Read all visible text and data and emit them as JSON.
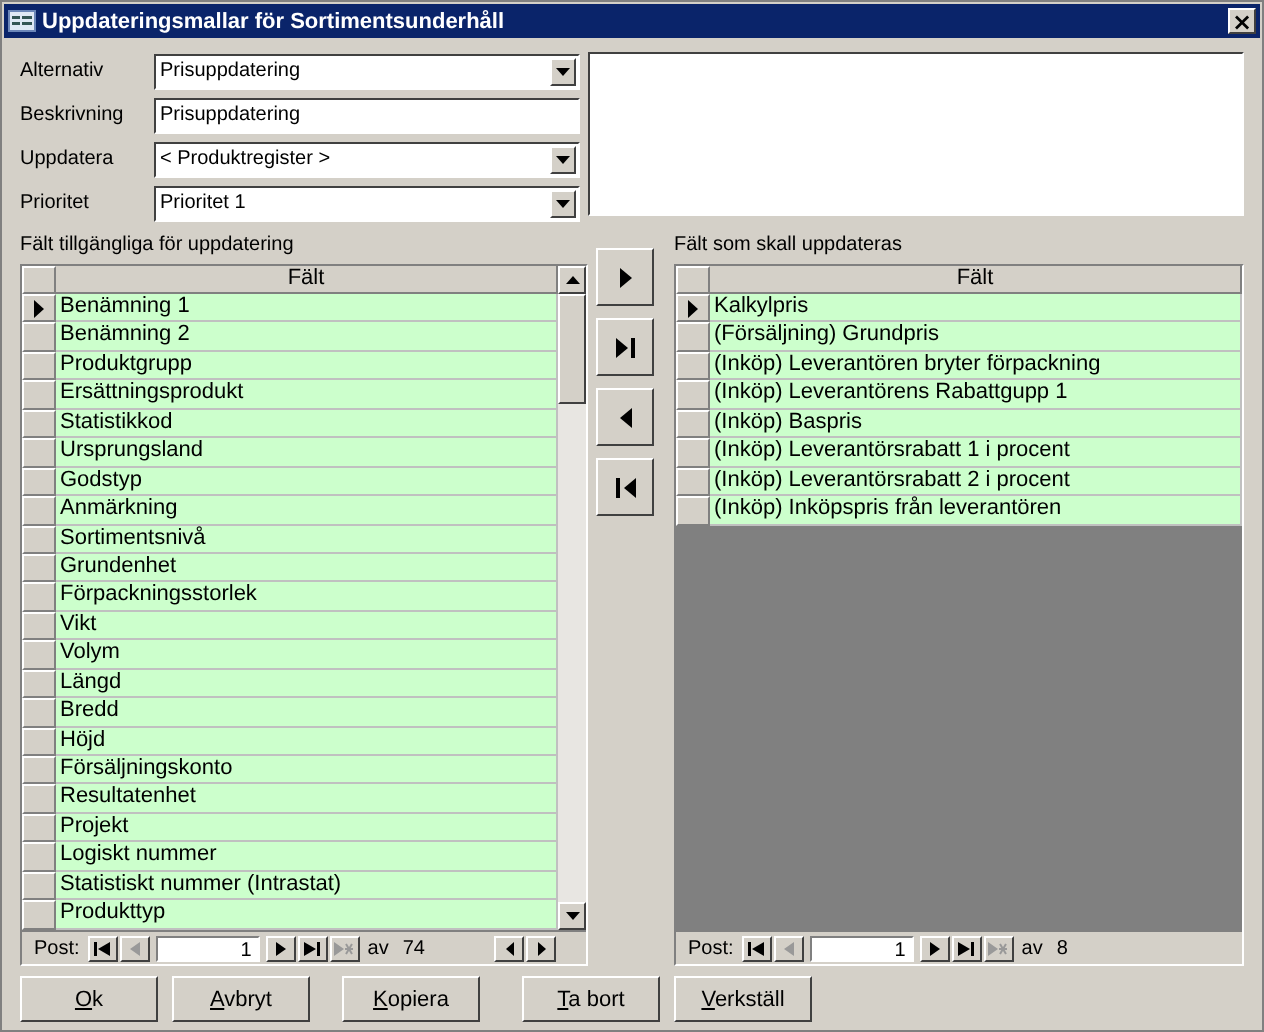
{
  "window": {
    "title": "Uppdateringsmallar för Sortimentsunderhåll",
    "close": "×"
  },
  "form": [
    {
      "label": "Alternativ",
      "value": "Prisuppdatering",
      "kind": "dropdown"
    },
    {
      "label": "Beskrivning",
      "value": "Prisuppdatering",
      "kind": "text"
    },
    {
      "label": "Uppdatera",
      "value": "< Produktregister >",
      "kind": "dropdown"
    },
    {
      "label": "Prioritet",
      "value": "Prioritet 1",
      "kind": "dropdown"
    }
  ],
  "available": {
    "caption": "Fält tillgängliga för uppdatering",
    "column": "Fält",
    "rows": [
      {
        "label": "Benämning 1",
        "selected": true
      },
      {
        "label": "Benämning 2",
        "selected": false
      },
      {
        "label": "Produktgrupp",
        "selected": false
      },
      {
        "label": "Ersättningsprodukt",
        "selected": false
      },
      {
        "label": "Statistikkod",
        "selected": false
      },
      {
        "label": "Ursprungsland",
        "selected": false
      },
      {
        "label": "Godstyp",
        "selected": false
      },
      {
        "label": "Anmärkning",
        "selected": false
      },
      {
        "label": "Sortimentsnivå",
        "selected": false
      },
      {
        "label": "Grundenhet",
        "selected": false
      },
      {
        "label": "Förpackningsstorlek",
        "selected": false
      },
      {
        "label": "Vikt",
        "selected": false
      },
      {
        "label": "Volym",
        "selected": false
      },
      {
        "label": "Längd",
        "selected": false
      },
      {
        "label": "Bredd",
        "selected": false
      },
      {
        "label": "Höjd",
        "selected": false
      },
      {
        "label": "Försäljningskonto",
        "selected": false
      },
      {
        "label": "Resultatenhet",
        "selected": false
      },
      {
        "label": "Projekt",
        "selected": false
      },
      {
        "label": "Logiskt nummer",
        "selected": false
      },
      {
        "label": "Statistiskt nummer (Intrastat)",
        "selected": false
      },
      {
        "label": "Produkttyp",
        "selected": false
      }
    ],
    "nav": {
      "label": "Post:",
      "record": "1",
      "of": "av",
      "total": "74"
    }
  },
  "selected_fields": {
    "caption": "Fält som skall uppdateras",
    "column": "Fält",
    "rows": [
      {
        "label": "Kalkylpris",
        "selected": true
      },
      {
        "label": "(Försäljning) Grundpris",
        "selected": false
      },
      {
        "label": "(Inköp) Leverantören bryter förpackning",
        "selected": false
      },
      {
        "label": "(Inköp) Leverantörens Rabattgupp 1",
        "selected": false
      },
      {
        "label": "(Inköp) Baspris",
        "selected": false
      },
      {
        "label": "(Inköp) Leverantörsrabatt 1 i procent",
        "selected": false
      },
      {
        "label": "(Inköp) Leverantörsrabatt 2 i procent",
        "selected": false
      },
      {
        "label": "(Inköp) Inköpspris från leverantören",
        "selected": false
      }
    ],
    "nav": {
      "label": "Post:",
      "record": "1",
      "of": "av",
      "total": "8"
    }
  },
  "buttons": [
    "Ok",
    "Avbryt",
    "Kopiera",
    "Ta bort",
    "Verkställ"
  ]
}
